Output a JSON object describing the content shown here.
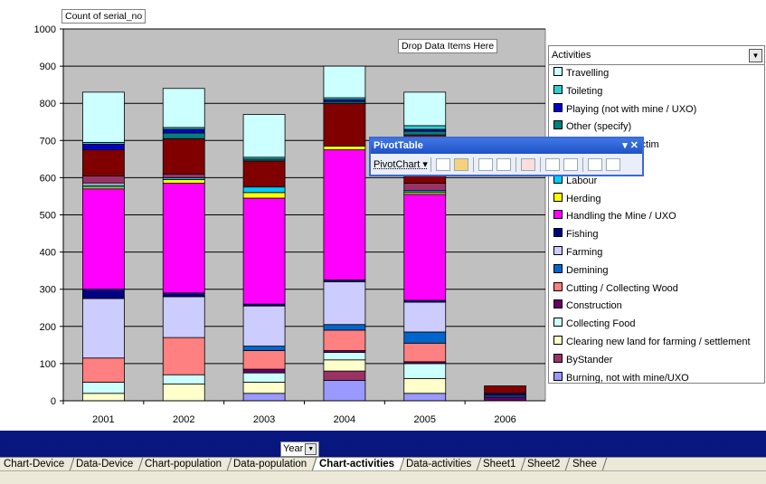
{
  "data_field": "Count of serial_no",
  "drop_zone": "Drop Data Items Here",
  "legend": {
    "title": "Activities",
    "items": [
      {
        "label": "Travelling",
        "color": "#ccffff"
      },
      {
        "label": "Toileting",
        "color": "#33cccc"
      },
      {
        "label": "Playing (not with mine / UXO)",
        "color": "#0000cc"
      },
      {
        "label": "Other (specify)",
        "color": "#008080"
      },
      {
        "label": "Playing beside victim",
        "color": "#ffffff"
      },
      {
        "label": "Other",
        "color": "#ffffff"
      },
      {
        "label": "Labour",
        "color": "#00ccff"
      },
      {
        "label": "Herding",
        "color": "#ffff00"
      },
      {
        "label": "Handling the Mine / UXO",
        "color": "#ff00ff"
      },
      {
        "label": "Fishing",
        "color": "#000080"
      },
      {
        "label": "Farming",
        "color": "#ccccff"
      },
      {
        "label": "Demining",
        "color": "#0066cc"
      },
      {
        "label": "Cutting / Collecting Wood",
        "color": "#ff8080"
      },
      {
        "label": "Construction",
        "color": "#660066"
      },
      {
        "label": "Collecting Food",
        "color": "#ccffff"
      },
      {
        "label": "Clearing new land for farming / settlement",
        "color": "#ffffcc"
      },
      {
        "label": "ByStander",
        "color": "#993366"
      },
      {
        "label": "Burning, not with mine/UXO",
        "color": "#9999ff"
      }
    ]
  },
  "pivot_toolbar": {
    "title": "PivotTable",
    "menu": "PivotChart ▾",
    "controls": "▾ ✕"
  },
  "axis_field": "Year",
  "tabs": [
    "Chart-Device",
    "Data-Device",
    "Chart-population",
    "Data-population",
    "Chart-activities",
    "Data-activities",
    "Sheet1",
    "Sheet2",
    "Shee"
  ],
  "active_tab": "Chart-activities",
  "chart_data": {
    "type": "bar",
    "stacked": true,
    "categories": [
      "2001",
      "2002",
      "2003",
      "2004",
      "2005",
      "2006"
    ],
    "ylim": [
      0,
      1000
    ],
    "yticks": [
      0,
      100,
      200,
      300,
      400,
      500,
      600,
      700,
      800,
      900,
      1000
    ],
    "grid": true,
    "series": [
      {
        "name": "Burning, not with mine/UXO",
        "color": "#9999ff",
        "values": [
          0,
          0,
          20,
          55,
          20,
          0
        ]
      },
      {
        "name": "ByStander",
        "color": "#993366",
        "values": [
          0,
          0,
          0,
          25,
          0,
          0
        ]
      },
      {
        "name": "Clearing new land for farming / settlement",
        "color": "#ffffcc",
        "values": [
          20,
          45,
          30,
          30,
          40,
          0
        ]
      },
      {
        "name": "Collecting Food",
        "color": "#ccffff",
        "values": [
          30,
          25,
          25,
          20,
          40,
          0
        ]
      },
      {
        "name": "Construction",
        "color": "#660066",
        "values": [
          0,
          0,
          10,
          5,
          5,
          10
        ]
      },
      {
        "name": "Cutting / Collecting Wood",
        "color": "#ff8080",
        "values": [
          65,
          100,
          50,
          55,
          50,
          0
        ]
      },
      {
        "name": "Demining",
        "color": "#0066cc",
        "values": [
          0,
          0,
          12,
          15,
          30,
          5
        ]
      },
      {
        "name": "Farming",
        "color": "#ccccff",
        "values": [
          160,
          110,
          108,
          115,
          80,
          0
        ]
      },
      {
        "name": "Fishing",
        "color": "#000080",
        "values": [
          25,
          10,
          5,
          5,
          5,
          5
        ]
      },
      {
        "name": "Handling the Mine / UXO",
        "color": "#ff00ff",
        "values": [
          270,
          295,
          285,
          350,
          285,
          0
        ]
      },
      {
        "name": "Herding",
        "color": "#ffff00",
        "values": [
          5,
          10,
          15,
          10,
          5,
          0
        ]
      },
      {
        "name": "Labour",
        "color": "#00ccff",
        "values": [
          5,
          5,
          15,
          0,
          5,
          0
        ]
      },
      {
        "name": "Other",
        "color": "#ffffff",
        "values": [
          5,
          0,
          0,
          0,
          0,
          0
        ]
      },
      {
        "name": "Playing beside victim",
        "color": "#ffffff",
        "values": [
          0,
          0,
          0,
          0,
          0,
          0
        ]
      },
      {
        "name": "Other (specify)",
        "color": "#993366",
        "values": [
          20,
          10,
          0,
          0,
          20,
          0
        ]
      },
      {
        "name": "Other (specify)",
        "color": "#800000",
        "values": [
          70,
          95,
          70,
          115,
          130,
          20
        ]
      },
      {
        "name": "Other (specify)",
        "color": "#008080",
        "values": [
          0,
          15,
          5,
          5,
          10,
          0
        ]
      },
      {
        "name": "Playing (not with mine / UXO)",
        "color": "#0000cc",
        "values": [
          15,
          10,
          0,
          5,
          5,
          0
        ]
      },
      {
        "name": "Toileting",
        "color": "#33cccc",
        "values": [
          5,
          5,
          5,
          5,
          10,
          0
        ]
      },
      {
        "name": "Travelling",
        "color": "#ccffff",
        "values": [
          135,
          105,
          115,
          85,
          90,
          0
        ]
      }
    ]
  }
}
